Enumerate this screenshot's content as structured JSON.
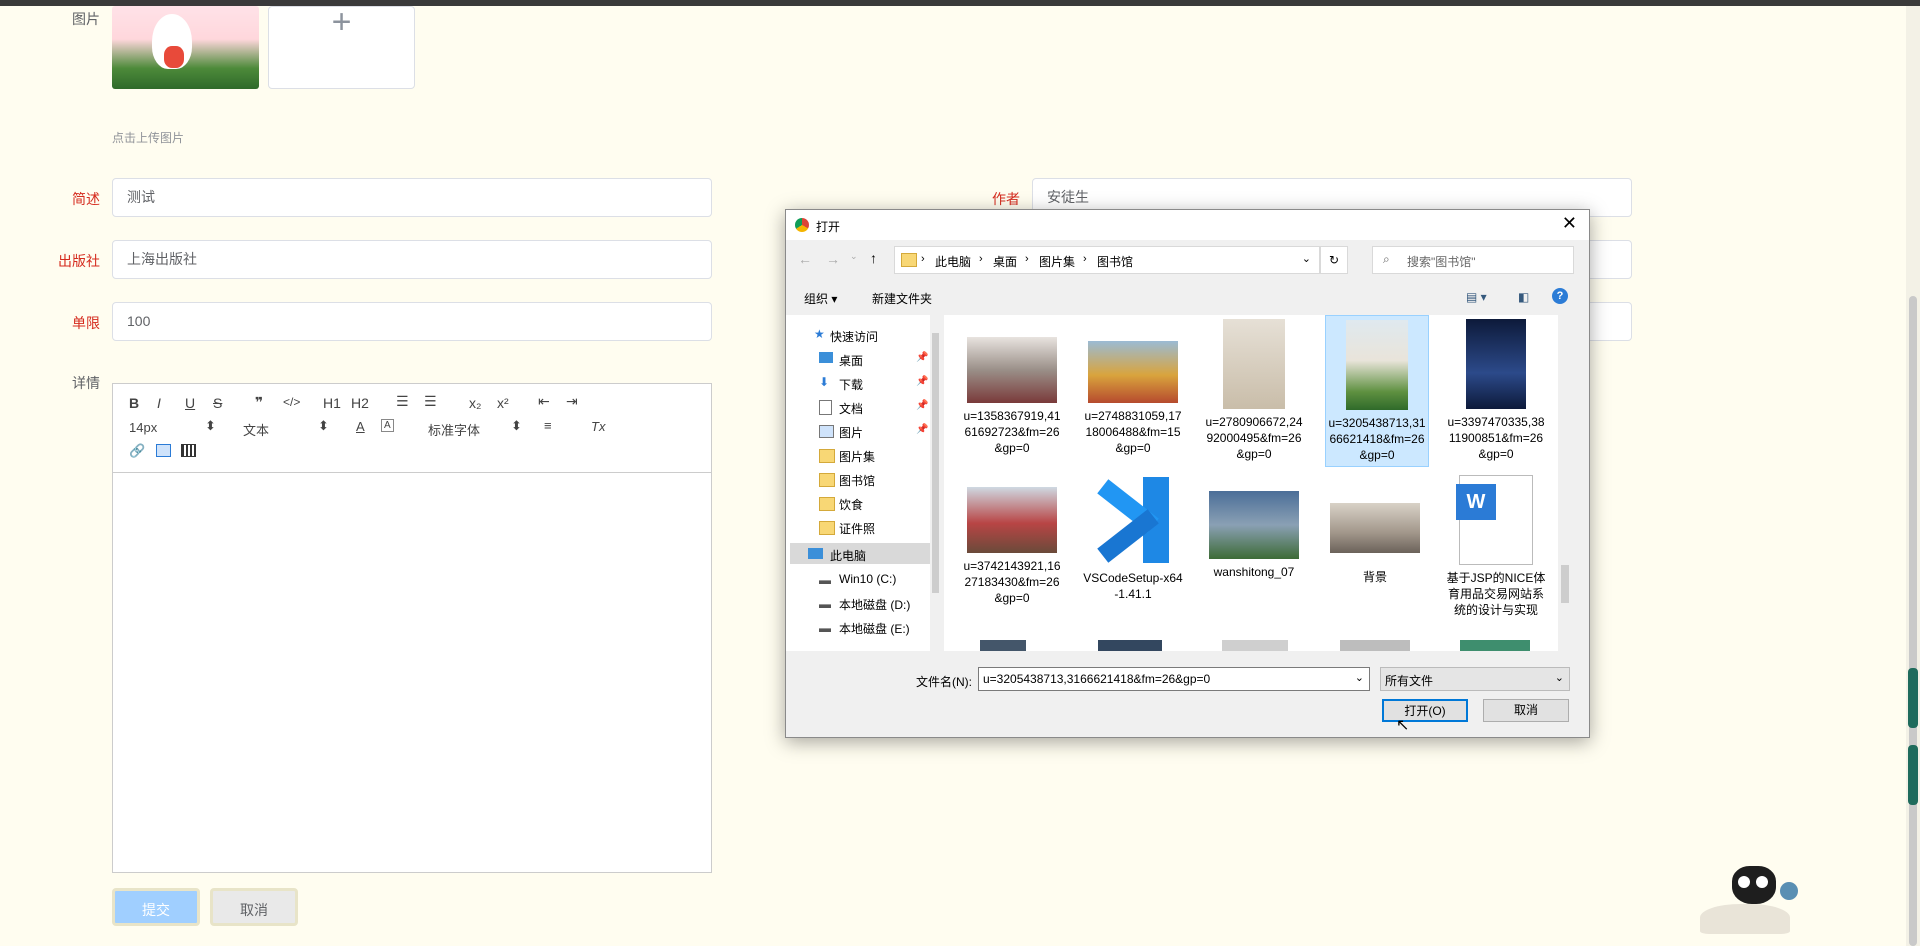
{
  "form": {
    "image_label": "图片",
    "upload_hint": "点击上传图片",
    "summary_label": "简述",
    "summary_value": "测试",
    "author_label": "作者",
    "author_value": "安徒生",
    "publisher_label": "出版社",
    "publisher_value": "上海出版社",
    "limit_label": "单限",
    "limit_value": "100",
    "detail_label": "详情",
    "plus_glyph": "+"
  },
  "editor": {
    "bold": "B",
    "italic": "I",
    "underline": "U",
    "strike": "S",
    "quote": "❞",
    "code": "</>",
    "h1": "H1",
    "h2": "H2",
    "sub": "x₂",
    "sup": "x²",
    "clear": "Tx",
    "font_size": "14px",
    "text_type": "文本",
    "font_family": "标准字体"
  },
  "buttons": {
    "submit": "提交",
    "cancel": "取消"
  },
  "dialog": {
    "title": "打开",
    "breadcrumb": [
      "此电脑",
      "桌面",
      "图片集",
      "图书馆"
    ],
    "search_placeholder": "搜索\"图书馆\"",
    "organize": "组织 ▾",
    "new_folder": "新建文件夹",
    "nav": {
      "quick_access": "快速访问",
      "items": [
        "桌面",
        "下载",
        "文档",
        "图片",
        "图片集",
        "图书馆",
        "饮食",
        "证件照"
      ],
      "this_pc": "此电脑",
      "drives": [
        "Win10 (C:)",
        "本地磁盘 (D:)",
        "本地磁盘 (E:)"
      ]
    },
    "files": [
      "u=1358367919,4161692723&fm=26&gp=0",
      "u=2748831059,1718006488&fm=15&gp=0",
      "u=2780906672,2492000495&fm=26&gp=0",
      "u=3205438713,3166621418&fm=26&gp=0",
      "u=3397470335,3811900851&fm=26&gp=0",
      "u=3742143921,1627183430&fm=26&gp=0",
      "VSCodeSetup-x64-1.41.1",
      "wanshitong_07",
      "背景",
      "基于JSP的NICE体育用品交易网站系统的设计与实现"
    ],
    "filename_label": "文件名(N):",
    "filename_value": "u=3205438713,3166621418&fm=26&gp=0",
    "filetype": "所有文件",
    "open_button": "打开(O)",
    "cancel_button": "取消"
  },
  "colors": {
    "label_red": "#d52b1e",
    "page_bg": "#fffdf0",
    "selected": "#cce8ff",
    "submit_bg": "#a0cfff"
  }
}
